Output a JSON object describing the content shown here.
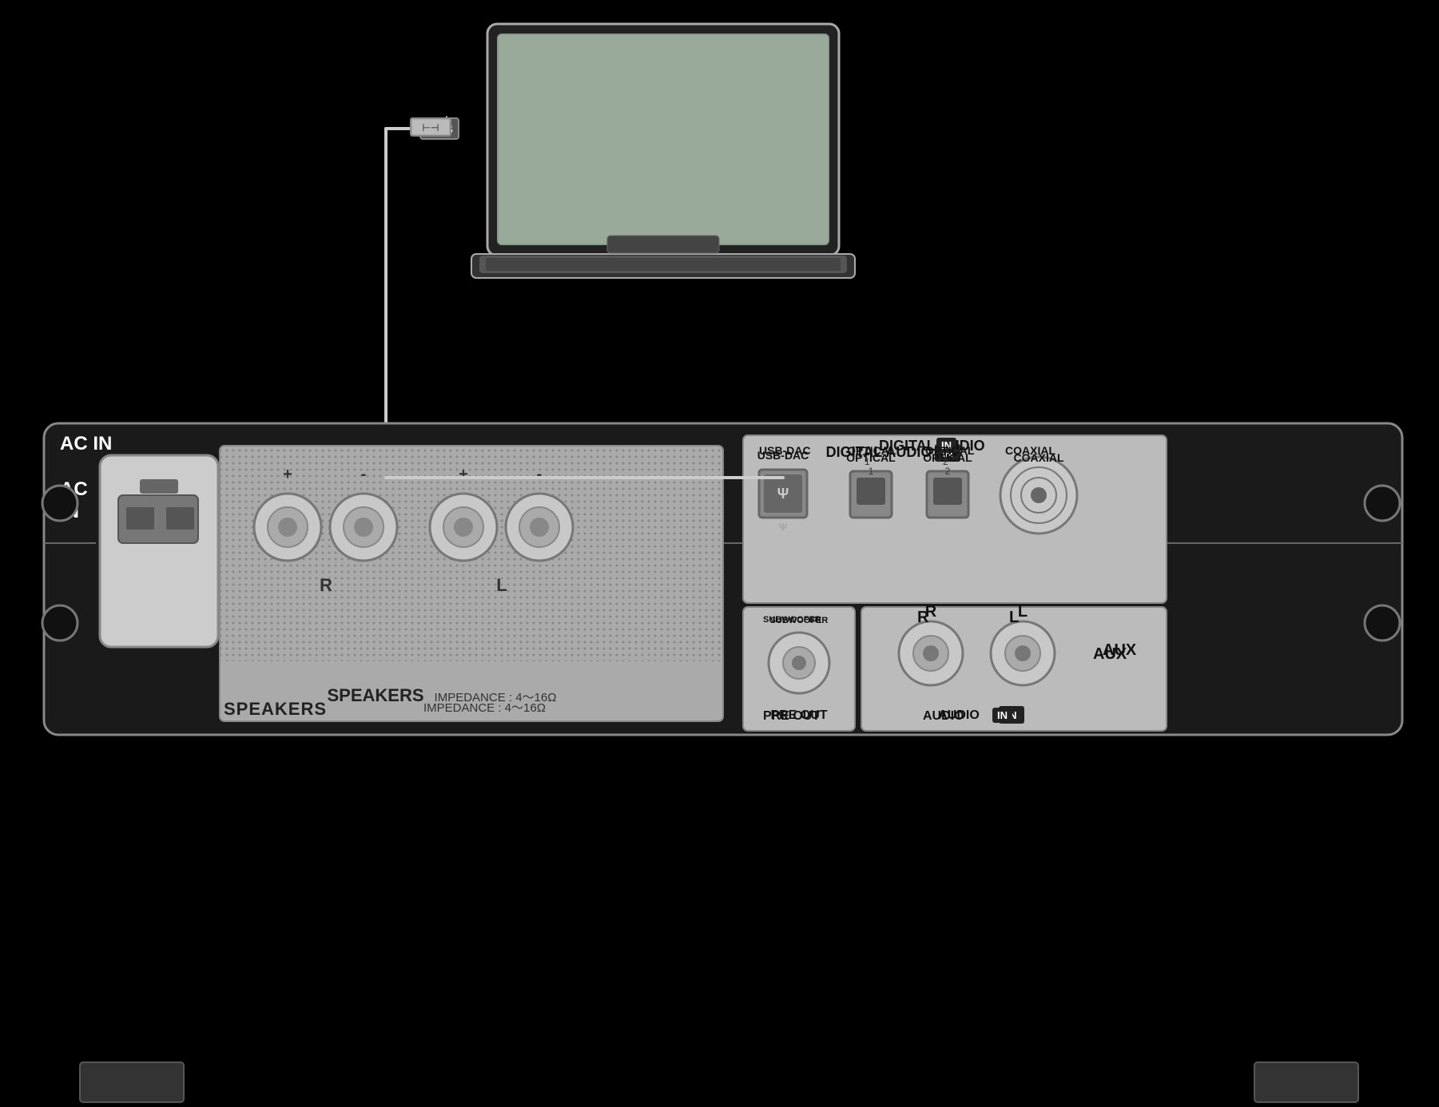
{
  "background": "#000000",
  "laptop": {
    "alt": "Laptop computer"
  },
  "cable": {
    "description": "USB cable connecting laptop to amplifier USB-DAC port"
  },
  "amplifier": {
    "ac_in": {
      "label": "AC\nIN"
    },
    "speakers": {
      "label": "SPEAKERS",
      "impedance": "IMPEDANCE : 4～16Ω",
      "terminals": [
        {
          "polarity": "+",
          "channel": ""
        },
        {
          "polarity": "-",
          "channel": ""
        },
        {
          "polarity": "+",
          "channel": ""
        },
        {
          "polarity": "-",
          "channel": ""
        }
      ],
      "channel_r": "R",
      "channel_l": "L"
    },
    "digital_audio": {
      "title": "DIGITAL AUDIO",
      "badge": "IN",
      "ports": [
        {
          "label": "USB-DAC",
          "sublabel": ""
        },
        {
          "label": "OPTICAL",
          "sublabel": "1"
        },
        {
          "label": "OPTICAL",
          "sublabel": "2"
        },
        {
          "label": "COAXIAL",
          "sublabel": ""
        }
      ]
    },
    "pre_out": {
      "label": "PRE OUT",
      "subwoofer": "SUBWOOFER"
    },
    "audio_in": {
      "title": "AUDIO",
      "badge": "IN",
      "aux_label": "AUX",
      "channels": [
        {
          "label": "R"
        },
        {
          "label": "L"
        }
      ]
    }
  }
}
